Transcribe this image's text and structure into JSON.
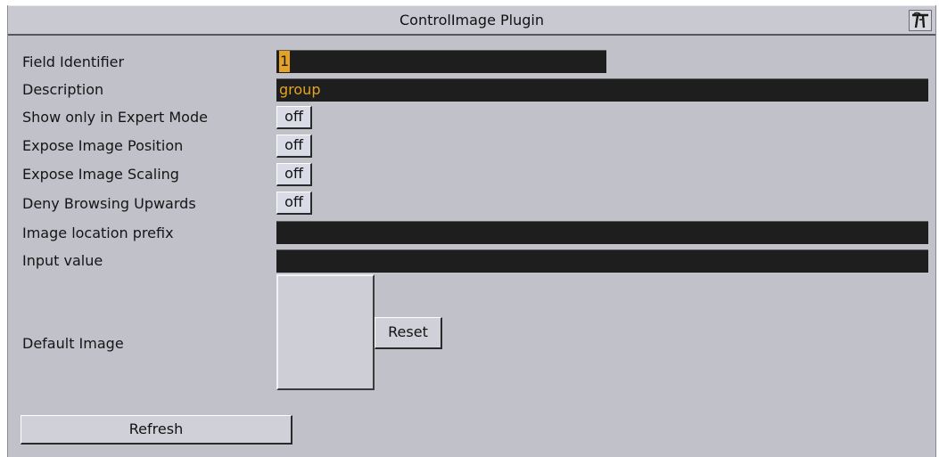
{
  "window": {
    "title": "ControlImage Plugin",
    "icon": "plugin-logo-icon"
  },
  "fields": {
    "field_identifier": {
      "label": "Field Identifier",
      "value": "1"
    },
    "description": {
      "label": "Description",
      "value": "group"
    },
    "show_expert": {
      "label": "Show only in Expert Mode",
      "value": "off"
    },
    "expose_position": {
      "label": "Expose Image Position",
      "value": "off"
    },
    "expose_scaling": {
      "label": "Expose Image Scaling",
      "value": "off"
    },
    "deny_browsing": {
      "label": "Deny Browsing Upwards",
      "value": "off"
    },
    "image_prefix": {
      "label": "Image location prefix",
      "value": ""
    },
    "input_value": {
      "label": "Input value",
      "value": ""
    },
    "default_image": {
      "label": "Default Image",
      "reset_label": "Reset"
    }
  },
  "footer": {
    "refresh_label": "Refresh"
  },
  "colors": {
    "panel": "#c0c1c9",
    "field_bg": "#1e1e1e",
    "field_text": "#e6a225",
    "toggle_bg": "#d9dbe6"
  }
}
